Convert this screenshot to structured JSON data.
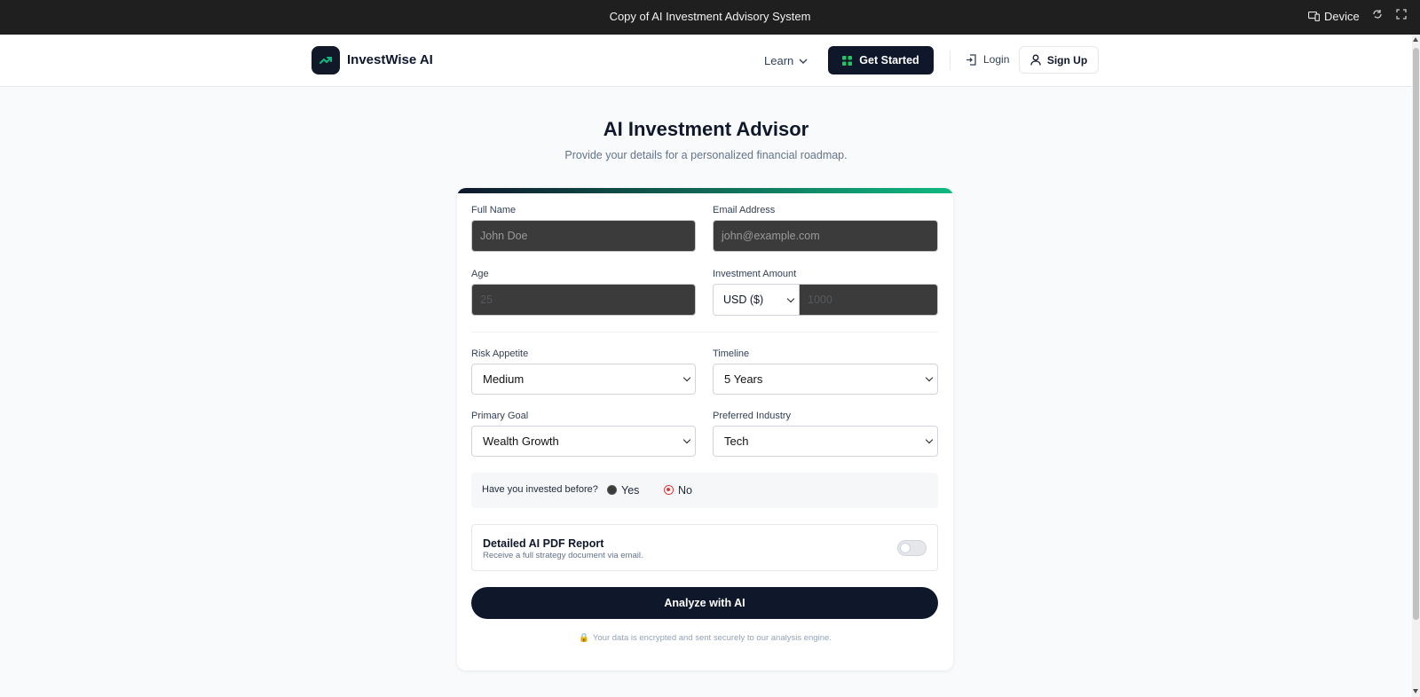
{
  "window": {
    "title": "Copy of AI Investment Advisory System",
    "device_label": "Device",
    "icons": [
      "device-icon",
      "refresh-icon",
      "fullscreen-icon"
    ]
  },
  "nav": {
    "brand": "InvestWise AI",
    "learn": "Learn",
    "get_started": "Get Started",
    "login": "Login",
    "sign_up": "Sign Up"
  },
  "hero": {
    "title": "AI Investment Advisor",
    "subtitle": "Provide your details for a personalized financial roadmap."
  },
  "form": {
    "full_name": {
      "label": "Full Name",
      "placeholder": "John Doe"
    },
    "email": {
      "label": "Email Address",
      "placeholder": "john@example.com"
    },
    "age": {
      "label": "Age",
      "placeholder": "25"
    },
    "investment": {
      "label": "Investment Amount",
      "currency": "USD ($)",
      "placeholder": "1000"
    },
    "risk": {
      "label": "Risk Appetite",
      "value": "Medium"
    },
    "timeline": {
      "label": "Timeline",
      "value": "5 Years"
    },
    "goal": {
      "label": "Primary Goal",
      "value": "Wealth Growth"
    },
    "industry": {
      "label": "Preferred Industry",
      "value": "Tech"
    },
    "invested_before": {
      "question": "Have you invested before?",
      "yes": "Yes",
      "no": "No",
      "selected": "No"
    },
    "pdf": {
      "title": "Detailed AI PDF Report",
      "subtitle": "Receive a full strategy document via email.",
      "enabled": false
    },
    "submit": "Analyze with AI",
    "secure_note": "Your data is encrypted and sent securely to our analysis engine."
  },
  "colors": {
    "primary": "#0f172a",
    "accent": "#10b981",
    "radio_selected": "#e03a3a"
  }
}
